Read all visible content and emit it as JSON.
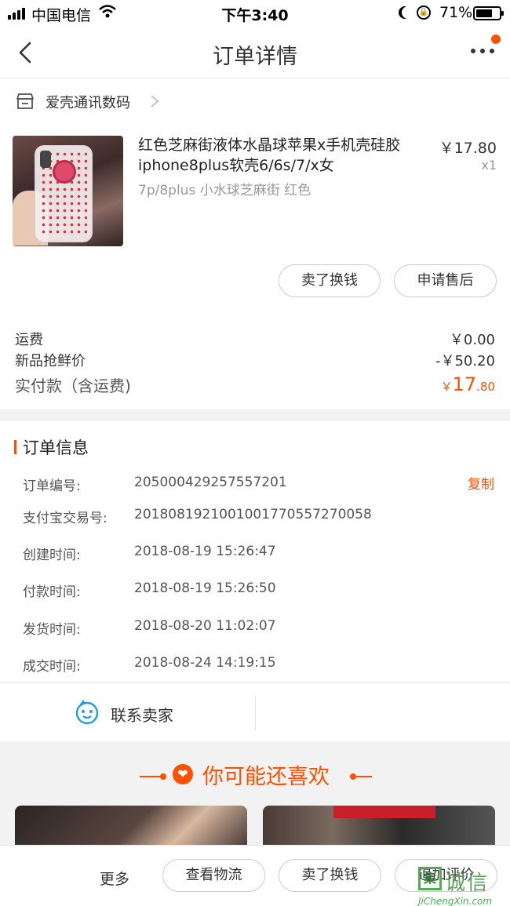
{
  "status_bar": {
    "carrier": "中国电信",
    "time": "下午3:40",
    "battery": "71%",
    "battery_level": 0.71
  },
  "nav": {
    "title": "订单详情"
  },
  "shop": {
    "name": "爱壳通讯数码"
  },
  "product": {
    "title": "红色芝麻街液体水晶球苹果x手机壳硅胶iphone8plus软壳6/6s/7/x女",
    "sku": "7p/8plus 小水球芝麻街 红色",
    "price": "￥17.80",
    "qty": "x1",
    "btn_sell": "卖了换钱",
    "btn_aftersale": "申请售后"
  },
  "fees": {
    "shipping_label": "运费",
    "shipping_value": "￥0.00",
    "discount_label": "新品抢鲜价",
    "discount_value": "-￥50.20",
    "total_label": "实付款（含运费)",
    "total_currency": "￥",
    "total_int": "17",
    "total_dec": ".80"
  },
  "order_info": {
    "heading": "订单信息",
    "copy": "复制",
    "rows": [
      {
        "label": "订单编号:",
        "value": "205000429257557201"
      },
      {
        "label": "支付宝交易号:",
        "value": "2018081921001001770557270058"
      },
      {
        "label": "创建时间:",
        "value": "2018-08-19 15:26:47"
      },
      {
        "label": "付款时间:",
        "value": "2018-08-19 15:26:50"
      },
      {
        "label": "发货时间:",
        "value": "2018-08-20 11:02:07"
      },
      {
        "label": "成交时间:",
        "value": "2018-08-24 14:19:15"
      }
    ]
  },
  "contact": {
    "label": "联系卖家"
  },
  "recommend": {
    "heading": "你可能还喜欢"
  },
  "bottom_bar": {
    "more": "更多",
    "btn_logistics": "查看物流",
    "btn_sell": "卖了换钱",
    "btn_review": "追加评价"
  },
  "watermark": {
    "cn": "诚信",
    "en": "JiChengXin.com",
    "box": "集"
  },
  "colors": {
    "accent": "#ff5000",
    "watermark": "#4caf50"
  }
}
